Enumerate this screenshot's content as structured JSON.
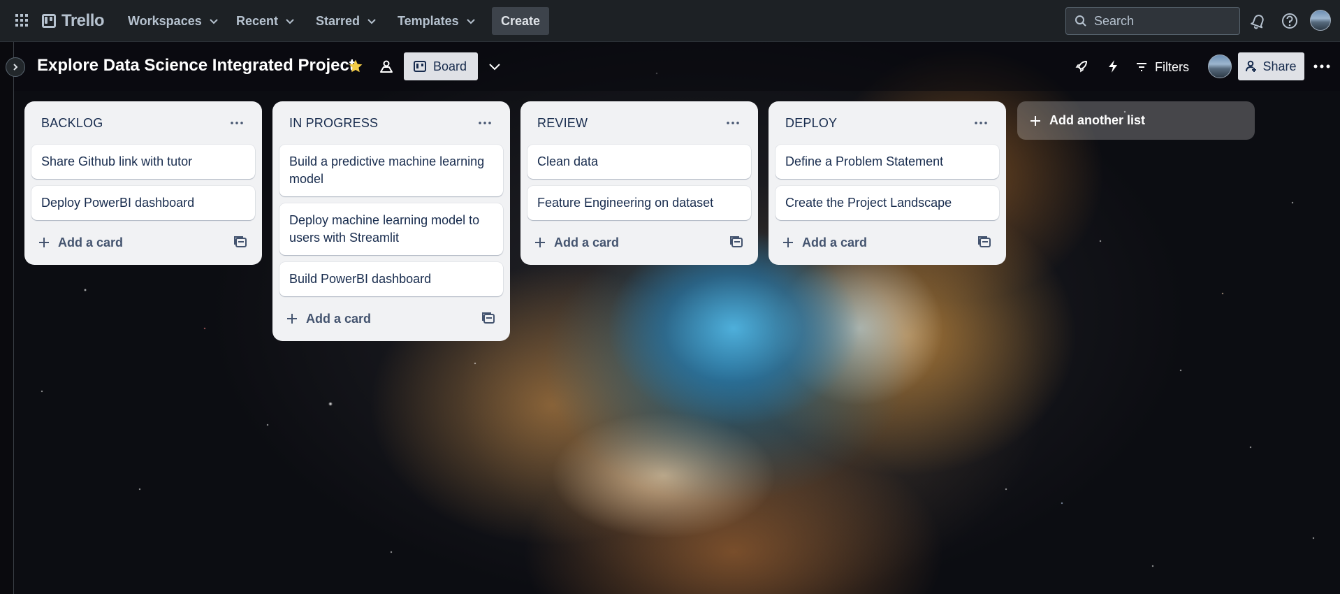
{
  "topbar": {
    "logo_text": "Trello",
    "nav": [
      {
        "label": "Workspaces"
      },
      {
        "label": "Recent"
      },
      {
        "label": "Starred"
      },
      {
        "label": "Templates"
      }
    ],
    "create_label": "Create",
    "search_placeholder": "Search",
    "icons": [
      "apps-grid-icon",
      "notifications-bell-icon",
      "help-icon",
      "account-avatar"
    ]
  },
  "board": {
    "title": "Explore Data Science Integrated Project",
    "starred": true,
    "view_label": "Board",
    "filters_label": "Filters",
    "share_label": "Share",
    "star_color": "#f5cd47"
  },
  "lists": [
    {
      "title": "BACKLOG",
      "cards": [
        "Share Github link with tutor",
        "Deploy PowerBI dashboard"
      ],
      "add_label": "Add a card"
    },
    {
      "title": "IN PROGRESS",
      "cards": [
        "Build a predictive machine learning model",
        "Deploy machine learning model to users with Streamlit",
        "Build PowerBI dashboard"
      ],
      "add_label": "Add a card"
    },
    {
      "title": "REVIEW",
      "cards": [
        "Clean data",
        "Feature Engineering on dataset"
      ],
      "add_label": "Add a card"
    },
    {
      "title": "DEPLOY",
      "cards": [
        "Define a Problem Statement",
        "Create the Project Landscape"
      ],
      "add_label": "Add a card"
    }
  ],
  "add_list_label": "Add another list"
}
